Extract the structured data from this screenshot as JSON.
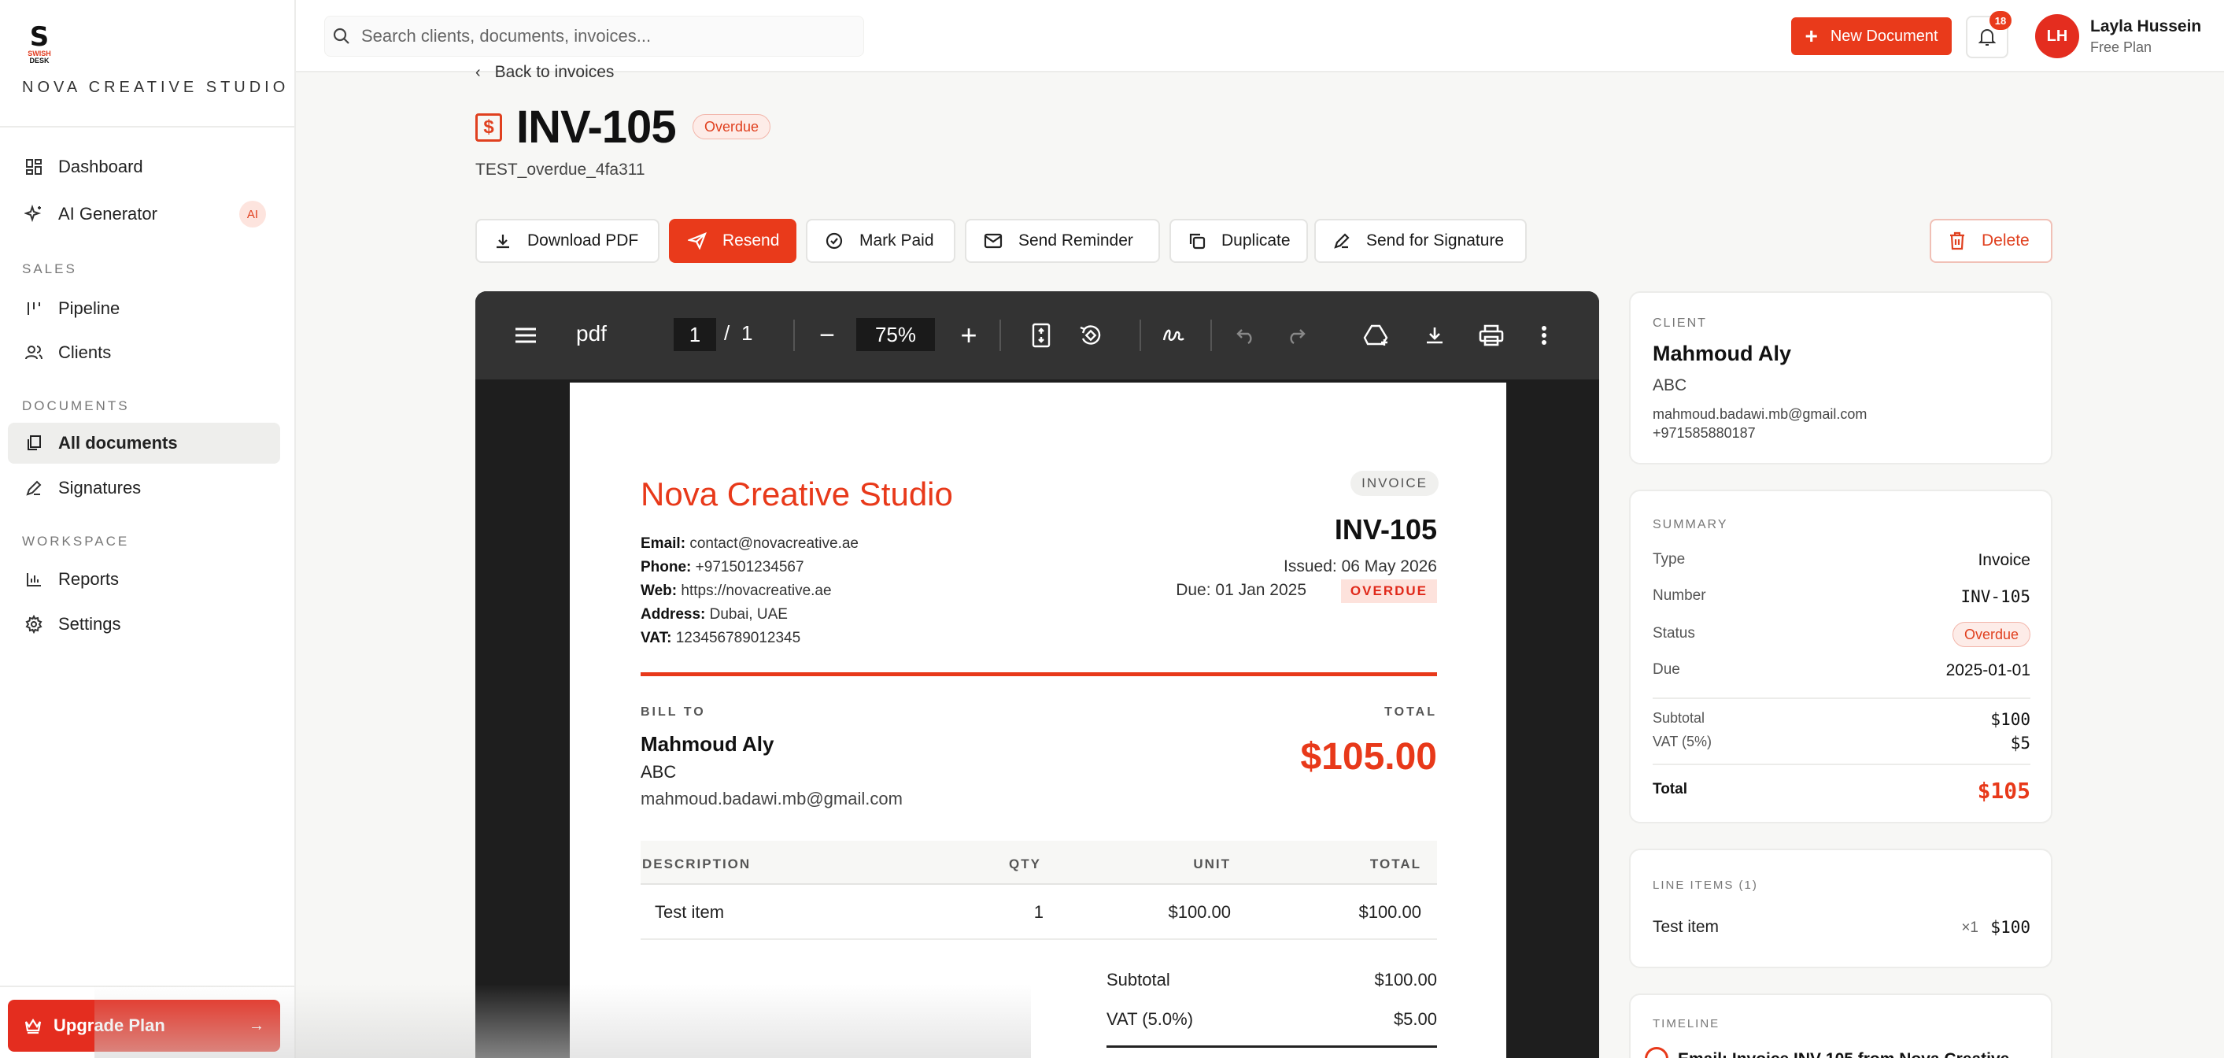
{
  "brand": {
    "logo_text": "S",
    "logo_sub1": "SWISH",
    "logo_sub2": "DESK",
    "name": "NOVA CREATIVE STUDIO"
  },
  "sidebar": {
    "items": [
      {
        "label": "Dashboard",
        "icon": "grid-icon"
      },
      {
        "label": "AI Generator",
        "icon": "sparkle-icon",
        "badge": "AI"
      }
    ],
    "sections": [
      {
        "title": "SALES",
        "items": [
          {
            "label": "Pipeline",
            "icon": "pipeline-icon"
          },
          {
            "label": "Clients",
            "icon": "users-icon"
          }
        ]
      },
      {
        "title": "DOCUMENTS",
        "items": [
          {
            "label": "All documents",
            "icon": "documents-icon",
            "active": true
          },
          {
            "label": "Signatures",
            "icon": "pen-icon"
          }
        ]
      },
      {
        "title": "WORKSPACE",
        "items": [
          {
            "label": "Reports",
            "icon": "bar-chart-icon"
          },
          {
            "label": "Settings",
            "icon": "gear-icon"
          }
        ]
      }
    ],
    "upgrade_label": "Upgrade Plan"
  },
  "topbar": {
    "search_placeholder": "Search clients, documents, invoices...",
    "new_document_label": "New Document",
    "notification_count": "18",
    "user": {
      "initials": "LH",
      "name": "Layla Hussein",
      "plan": "Free Plan"
    }
  },
  "header": {
    "back_label": "Back to invoices",
    "title": "INV-105",
    "status": "Overdue",
    "subtitle": "TEST_overdue_4fa311"
  },
  "actions": {
    "download_pdf": "Download PDF",
    "resend": "Resend",
    "mark_paid": "Mark Paid",
    "send_reminder": "Send Reminder",
    "duplicate": "Duplicate",
    "send_signature": "Send for Signature",
    "delete": "Delete"
  },
  "viewer": {
    "title": "pdf",
    "current_page": "1",
    "separator": "/",
    "total_pages": "1",
    "zoom": "75%"
  },
  "pdf": {
    "company": "Nova Creative Studio",
    "info": [
      {
        "label": "Email:",
        "value": "contact@novacreative.ae"
      },
      {
        "label": "Phone:",
        "value": "+971501234567"
      },
      {
        "label": "Web:",
        "value": "https://novacreative.ae"
      },
      {
        "label": "Address:",
        "value": "Dubai, UAE"
      },
      {
        "label": "VAT:",
        "value": "123456789012345"
      }
    ],
    "doc_type": "INVOICE",
    "number": "INV-105",
    "issued": "Issued: 06 May 2026",
    "due": "Due: 01 Jan 2025",
    "status": "OVERDUE",
    "bill_to_label": "BILL TO",
    "total_label": "TOTAL",
    "client_name": "Mahmoud Aly",
    "client_company": "ABC",
    "client_email": "mahmoud.badawi.mb@gmail.com",
    "total_amount": "$105.00",
    "table_headers": {
      "description": "DESCRIPTION",
      "qty": "QTY",
      "unit": "UNIT",
      "total": "TOTAL"
    },
    "rows": [
      {
        "description": "Test item",
        "qty": "1",
        "unit": "$100.00",
        "total": "$100.00"
      }
    ],
    "subtotal_label": "Subtotal",
    "subtotal": "$100.00",
    "vat_label": "VAT (5.0%)",
    "vat": "$5.00"
  },
  "client_card": {
    "label": "CLIENT",
    "name": "Mahmoud Aly",
    "company": "ABC",
    "email": "mahmoud.badawi.mb@gmail.com",
    "phone": "+971585880187"
  },
  "summary_card": {
    "label": "SUMMARY",
    "type_key": "Type",
    "type_val": "Invoice",
    "number_key": "Number",
    "number_val": "INV-105",
    "status_key": "Status",
    "status_val": "Overdue",
    "due_key": "Due",
    "due_val": "2025-01-01",
    "subtotal_key": "Subtotal",
    "subtotal_val": "$100",
    "vat_key": "VAT (5%)",
    "vat_val": "$5",
    "total_key": "Total",
    "total_val": "$105"
  },
  "line_items_card": {
    "label": "LINE ITEMS (1)",
    "items": [
      {
        "name": "Test item",
        "qty": "×1",
        "amount": "$100"
      }
    ]
  },
  "timeline_card": {
    "label": "TIMELINE",
    "first_entry": "Email: Invoice INV-105 from Nova Creative"
  },
  "colors": {
    "accent": "#e93a1b",
    "overdue_bg": "#fdece8",
    "sidebar_bg": "#ffffff",
    "page_bg": "#f7f7f5",
    "viewer_toolbar": "#333333"
  }
}
